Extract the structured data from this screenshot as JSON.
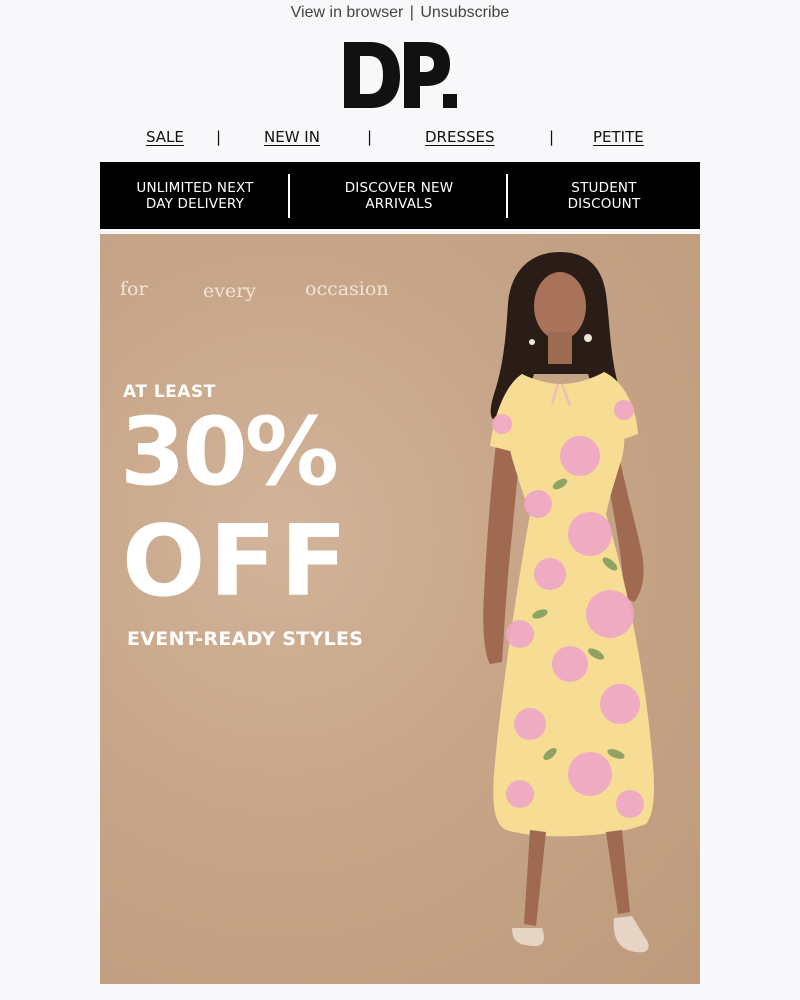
{
  "header": {
    "view_in_browser": "View in browser",
    "separator": "|",
    "unsubscribe": "Unsubscribe",
    "logo_text": "DP."
  },
  "nav": {
    "items": [
      {
        "label": "SALE"
      },
      {
        "label": "NEW IN"
      },
      {
        "label": "DRESSES"
      },
      {
        "label": "PETITE"
      }
    ],
    "separator": "|"
  },
  "usp_bar": {
    "items": [
      {
        "line1": "UNLIMITED NEXT",
        "line2": "DAY DELIVERY"
      },
      {
        "line1": "DISCOVER NEW",
        "line2": "ARRIVALS"
      },
      {
        "line1": "STUDENT",
        "line2": "DISCOUNT"
      }
    ]
  },
  "hero": {
    "tagline": [
      "for",
      "every",
      "occasion"
    ],
    "pre_headline": "AT LEAST",
    "headline_percent": "30%",
    "headline_off": "OFF",
    "subheadline": "EVENT-READY STYLES"
  },
  "colors": {
    "background": "#f8f8fa",
    "usp_bar": "#000000",
    "hero_background": "#c8a689",
    "dress_yellow": "#f7dd94",
    "flower_pink": "#eea7c5"
  }
}
